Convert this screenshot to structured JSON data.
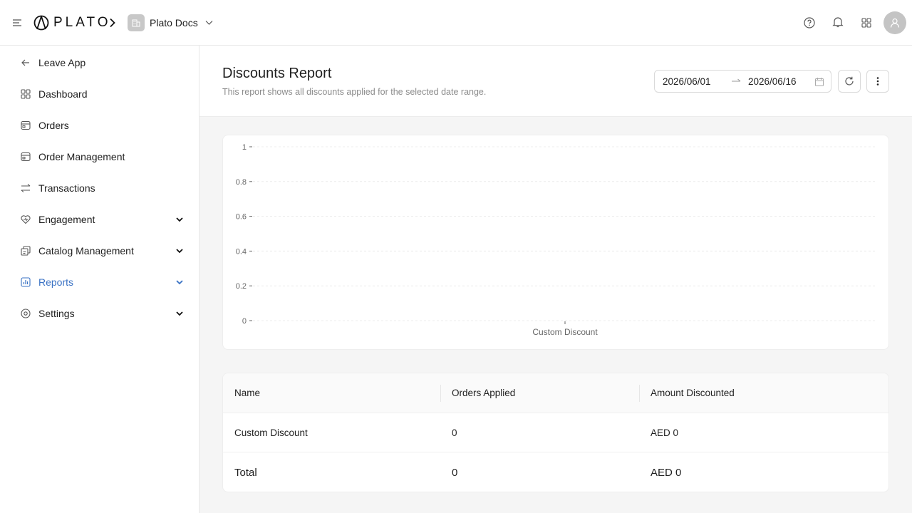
{
  "topbar": {
    "logo_text": "PLATO",
    "org_name": "Plato Docs",
    "icons": [
      "menu-icon",
      "help-icon",
      "bell-icon",
      "apps-grid-icon",
      "user-icon"
    ]
  },
  "sidebar": {
    "items": [
      {
        "label": "Leave App",
        "icon": "arrow-left-icon",
        "expandable": false,
        "active": false
      },
      {
        "label": "Dashboard",
        "icon": "dashboard-icon",
        "expandable": false,
        "active": false
      },
      {
        "label": "Orders",
        "icon": "orders-icon",
        "expandable": false,
        "active": false
      },
      {
        "label": "Order Management",
        "icon": "order-management-icon",
        "expandable": false,
        "active": false
      },
      {
        "label": "Transactions",
        "icon": "transactions-icon",
        "expandable": false,
        "active": false
      },
      {
        "label": "Engagement",
        "icon": "heart-icon",
        "expandable": true,
        "active": false
      },
      {
        "label": "Catalog Management",
        "icon": "catalog-icon",
        "expandable": true,
        "active": false
      },
      {
        "label": "Reports",
        "icon": "reports-icon",
        "expandable": true,
        "active": true
      },
      {
        "label": "Settings",
        "icon": "settings-icon",
        "expandable": true,
        "active": false
      }
    ]
  },
  "page": {
    "title": "Discounts Report",
    "subtitle": "This report shows all discounts applied for the selected date range.",
    "date_start": "2026/06/01",
    "date_end": "2026/06/16"
  },
  "colors": {
    "accent": "#3a72c4",
    "muted_text": "#8c8c8c",
    "border": "#d9d9d9"
  },
  "chart_data": {
    "type": "bar",
    "categories": [
      "Custom Discount"
    ],
    "values": [
      0
    ],
    "ylim": [
      0,
      1
    ],
    "yticks": [
      "0",
      "0.2",
      "0.4",
      "0.6",
      "0.8",
      "1"
    ],
    "grid": true,
    "xlabel": "",
    "ylabel": ""
  },
  "table": {
    "columns": [
      "Name",
      "Orders Applied",
      "Amount Discounted"
    ],
    "rows": [
      [
        "Custom Discount",
        "0",
        "AED 0"
      ]
    ],
    "total": [
      "Total",
      "0",
      "AED 0"
    ]
  }
}
